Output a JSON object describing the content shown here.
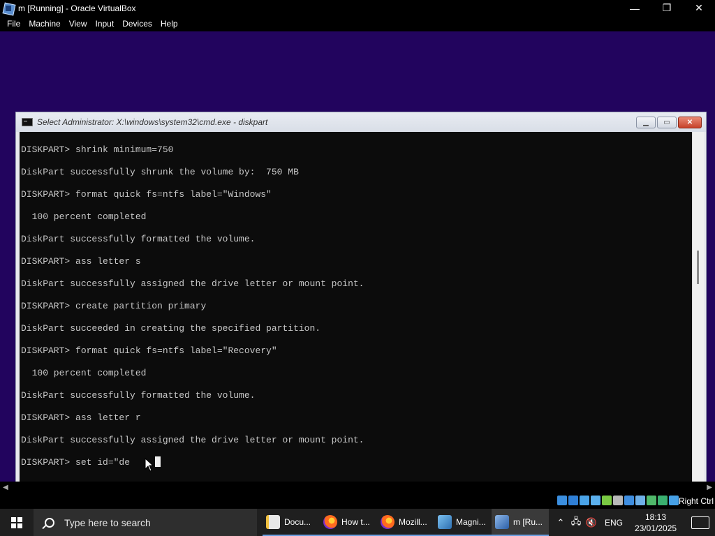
{
  "window": {
    "title": "m [Running] - Oracle VirtualBox",
    "minimize": "—",
    "restore": "❐",
    "close": "✕"
  },
  "menu": [
    "File",
    "Machine",
    "View",
    "Input",
    "Devices",
    "Help"
  ],
  "cmd": {
    "title": "Select Administrator: X:\\windows\\system32\\cmd.exe - diskpart",
    "lines": [
      "DISKPART> shrink minimum=750",
      "DiskPart successfully shrunk the volume by:  750 MB",
      "DISKPART> format quick fs=ntfs label=\"Windows\"",
      "  100 percent completed",
      "DiskPart successfully formatted the volume.",
      "DISKPART> ass letter s",
      "DiskPart successfully assigned the drive letter or mount point.",
      "DISKPART> create partition primary",
      "DiskPart succeeded in creating the specified partition.",
      "DISKPART> format quick fs=ntfs label=\"Recovery\"",
      "  100 percent completed",
      "DiskPart successfully formatted the volume.",
      "DISKPART> ass letter r",
      "DiskPart successfully assigned the drive letter or mount point.",
      "DISKPART> set id=\"de"
    ]
  },
  "statusbar": {
    "host_key": "Right Ctrl",
    "icon_colors": [
      "#3b8fe0",
      "#2f7fd6",
      "#4aa3e8",
      "#5bb0ee",
      "#7ac943",
      "#b8b8b8",
      "#3f8ee0",
      "#6fb0e8",
      "#4fb86a",
      "#3ab070",
      "#46a0e6"
    ]
  },
  "taskbar": {
    "search_placeholder": "Type here to search",
    "items": [
      {
        "label": "Docu...",
        "icon": "document-icon"
      },
      {
        "label": "How t...",
        "icon": "firefox-icon"
      },
      {
        "label": "Mozill...",
        "icon": "firefox-icon"
      },
      {
        "label": "Magni...",
        "icon": "magnifier-icon"
      },
      {
        "label": "m [Ru...",
        "icon": "virtualbox-icon"
      }
    ],
    "tray": {
      "language": "ENG",
      "time": "18:13",
      "date": "23/01/2025"
    }
  }
}
